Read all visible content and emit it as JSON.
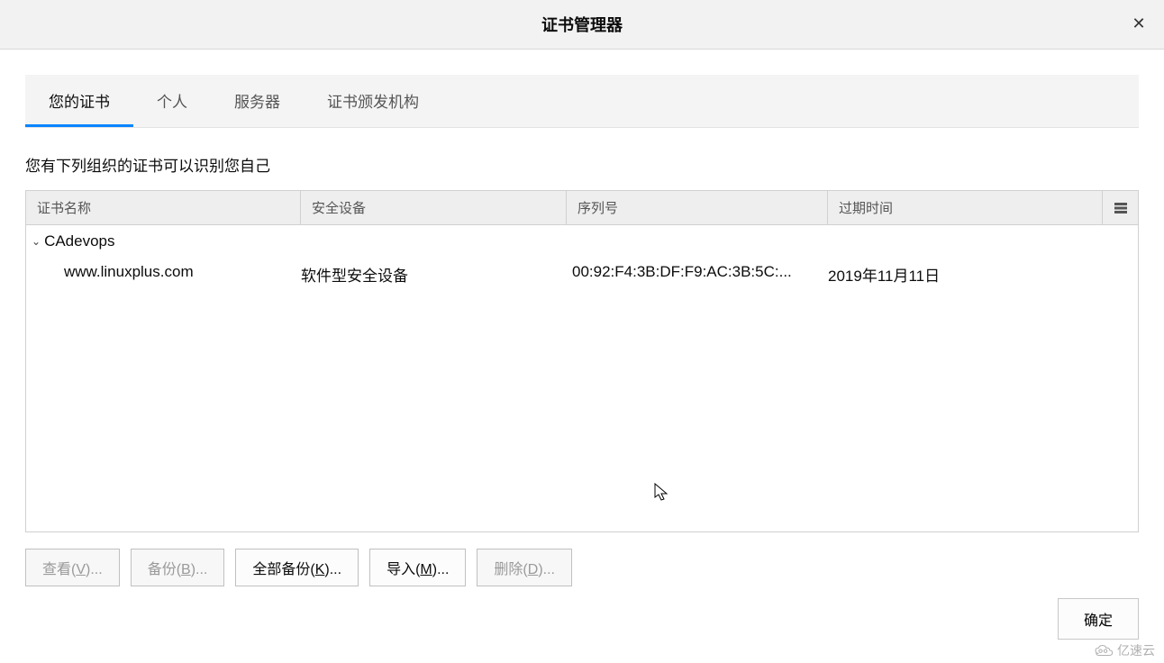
{
  "window": {
    "title": "证书管理器"
  },
  "tabs": [
    {
      "id": "your",
      "label": "您的证书",
      "active": true
    },
    {
      "id": "personal",
      "label": "个人",
      "active": false
    },
    {
      "id": "server",
      "label": "服务器",
      "active": false
    },
    {
      "id": "ca",
      "label": "证书颁发机构",
      "active": false
    }
  ],
  "description": "您有下列组织的证书可以识别您自己",
  "columns": {
    "name": "证书名称",
    "device": "安全设备",
    "serial": "序列号",
    "expiration": "过期时间"
  },
  "tree": {
    "group": "CAdevops",
    "rows": [
      {
        "name": "www.linuxplus.com",
        "device": "软件型安全设备",
        "serial": "00:92:F4:3B:DF:F9:AC:3B:5C:...",
        "expiration": "2019年11月11日"
      }
    ]
  },
  "buttons": {
    "view": {
      "label": "查看",
      "key": "V",
      "suffix": "...",
      "enabled": false
    },
    "backup": {
      "label": "备份",
      "key": "B",
      "suffix": "...",
      "enabled": false
    },
    "backupAll": {
      "label": "全部备份",
      "key": "K",
      "suffix": "...",
      "enabled": true
    },
    "import": {
      "label": "导入",
      "key": "M",
      "suffix": "...",
      "enabled": true
    },
    "delete": {
      "label": "删除",
      "key": "D",
      "suffix": "...",
      "enabled": false
    },
    "ok": "确定"
  },
  "watermark": "亿速云"
}
